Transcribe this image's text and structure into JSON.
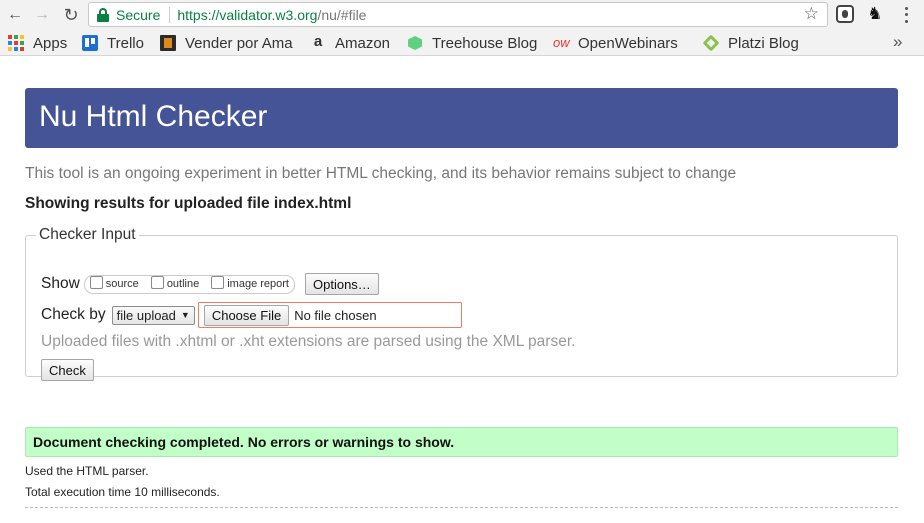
{
  "browser": {
    "back_glyph": "←",
    "forward_glyph": "→",
    "reload_glyph": "↻",
    "secure_label": "Secure",
    "url_host": "https://validator.w3.org",
    "url_path": "/nu/#file",
    "star_glyph": "☆",
    "ext2_glyph": "♞",
    "bookmarks_more": "»"
  },
  "bookmarks": [
    {
      "label": "Apps",
      "icon": "apps-grid-icon"
    },
    {
      "label": "Trello",
      "icon": "trello-icon"
    },
    {
      "label": "Vender por Ama",
      "icon": "vender-icon"
    },
    {
      "label": "Amazon",
      "icon": "amazon-icon"
    },
    {
      "label": "Treehouse Blog",
      "icon": "treehouse-icon"
    },
    {
      "label": "OpenWebinars",
      "icon": "openwebinars-icon"
    },
    {
      "label": "Platzi Blog",
      "icon": "platzi-icon"
    }
  ],
  "page": {
    "title": "Nu Html Checker",
    "intro": "This tool is an ongoing experiment in better HTML checking, and its behavior remains subject to change",
    "showing": "Showing results for uploaded file index.html",
    "checker_legend": "Checker Input",
    "show_label": "Show",
    "show_options": [
      "source",
      "outline",
      "image report"
    ],
    "options_button": "Options…",
    "check_by_label": "Check by",
    "check_by_value": "file upload",
    "choose_file_button": "Choose File",
    "no_file_text": "No file chosen",
    "hint": "Uploaded files with .xhtml or .xht extensions are parsed using the XML parser.",
    "check_button": "Check",
    "result_message": "Document checking completed. No errors or warnings to show.",
    "parser_info": "Used the HTML parser.",
    "execution_info": "Total execution time 10 milliseconds."
  },
  "colors": {
    "header_bg": "#445496",
    "result_bg": "#c2ffc8",
    "secure_green": "#0b8043",
    "file_border": "#e97e60"
  }
}
